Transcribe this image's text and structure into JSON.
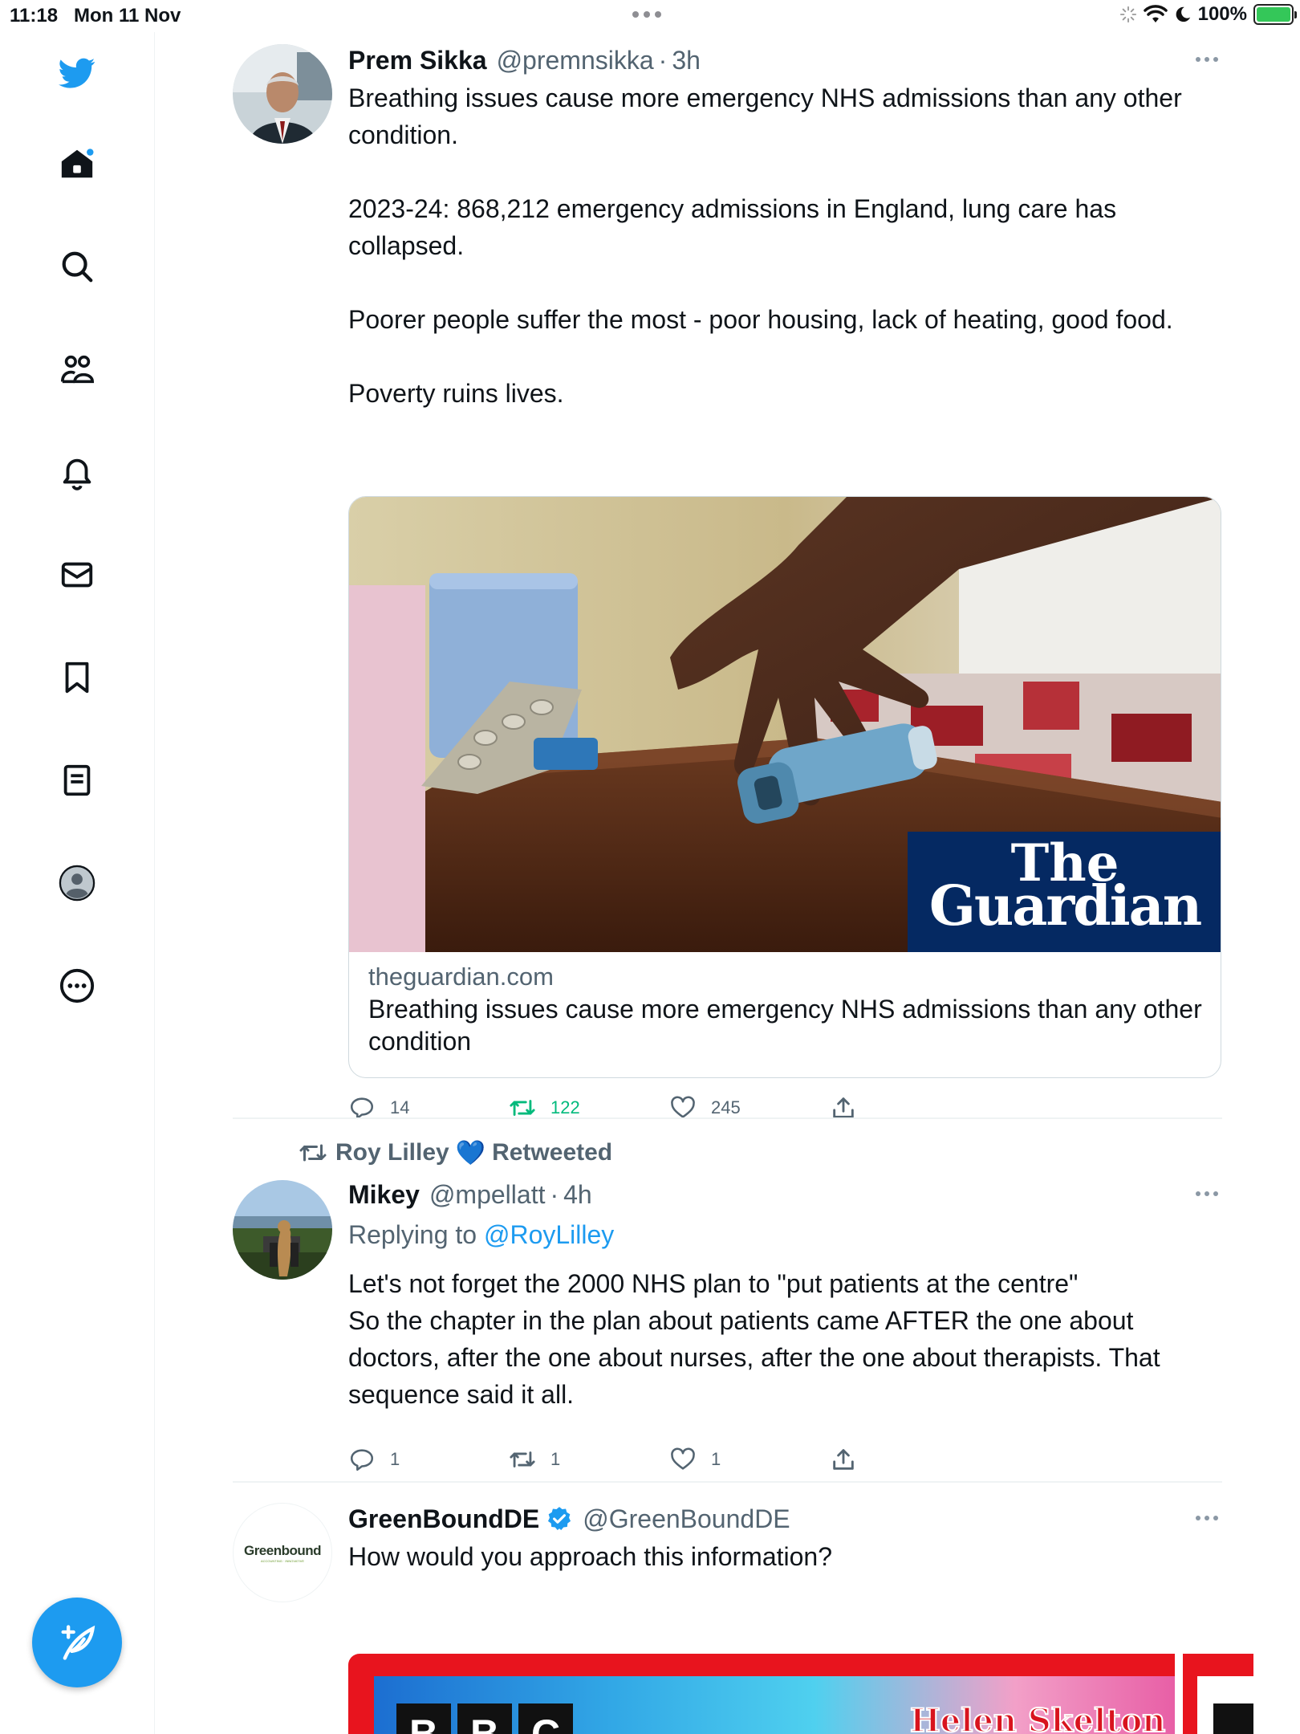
{
  "status_bar": {
    "time": "11:18",
    "date": "Mon 11 Nov",
    "battery": "100%"
  },
  "sidebar": {
    "items": [
      {
        "icon": "twitter-bird-icon"
      },
      {
        "icon": "home-icon"
      },
      {
        "icon": "search-icon"
      },
      {
        "icon": "communities-icon"
      },
      {
        "icon": "notifications-bell-icon"
      },
      {
        "icon": "messages-mail-icon"
      },
      {
        "icon": "bookmark-icon"
      },
      {
        "icon": "lists-icon"
      },
      {
        "icon": "profile-icon"
      },
      {
        "icon": "more-icon"
      }
    ],
    "compose_icon": "compose-feather-icon"
  },
  "tweets": [
    {
      "name": "Prem Sikka",
      "handle": "@premnsikka",
      "dot": "·",
      "time": "3h",
      "text": "Breathing issues cause more emergency NHS admissions than any other condition.\n\n2023-24: 868,212 emergency admissions in England, lung care has collapsed.\n\nPoorer people suffer the most - poor housing, lack of heating, good food.\n\nPoverty ruins lives.",
      "card": {
        "domain": "theguardian.com",
        "title": "Breathing issues cause more emergency NHS admissions than any other condition",
        "logo_line1": "The",
        "logo_line2": "Guardian"
      },
      "replies": "14",
      "retweets": "122",
      "likes": "245"
    },
    {
      "retweeted_by": "Roy Lilley",
      "retweeted_badge": "💙",
      "retweeted_label": "Retweeted",
      "name": "Mikey",
      "handle": "@mpellatt",
      "dot": "·",
      "time": "4h",
      "replying_prefix": "Replying to",
      "replying_to": "@RoyLilley",
      "text": "Let's not forget the 2000 NHS plan to \"put patients at the centre\"\nSo the chapter in the plan about patients came AFTER the one about doctors, after the one about nurses, after the one about therapists. That sequence said it all.",
      "replies": "1",
      "retweets": "1",
      "likes": "1"
    },
    {
      "name": "GreenBoundDE",
      "handle": "@GreenBoundDE",
      "text": "How would you approach this information?",
      "avatar_text": "Greenbound",
      "avatar_subtext": "ACCOUNTING · INNOVATIVE",
      "media_bbc": "BBC",
      "media_caption": "Helen Skelton"
    }
  ],
  "colors": {
    "accent": "#1d9bf0",
    "retweet": "#00ba7c",
    "secondary_text": "#536471",
    "guardian_blue": "#052962",
    "bbc_red": "#e8141e"
  }
}
